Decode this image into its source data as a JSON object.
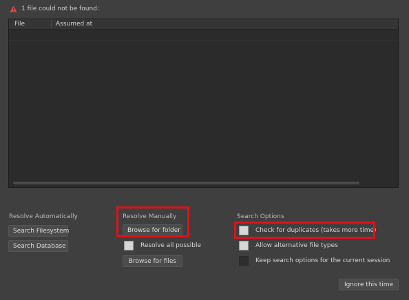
{
  "header": {
    "warning_text": "1 file could not be found:",
    "icon": "warning-triangle-icon",
    "icon_color": "#e04a4a"
  },
  "table": {
    "columns": [
      "File",
      "Assumed at"
    ],
    "rows": []
  },
  "resolve_automatically": {
    "title": "Resolve Automatically",
    "search_filesystem": "Search Filesystem",
    "search_database": "Search Database"
  },
  "resolve_manually": {
    "title": "Resolve Manually",
    "browse_folder": "Browse for folder",
    "resolve_all_label": "Resolve all possible",
    "resolve_all_checked": false,
    "browse_files": "Browse for files"
  },
  "search_options": {
    "title": "Search Options",
    "check_duplicates": "Check for duplicates (takes more time)",
    "allow_alt_types": "Allow alternative file types",
    "keep_options": "Keep search options for the current session"
  },
  "footer": {
    "ignore_label": "Ignore this time"
  },
  "colors": {
    "background": "#3f3f3f",
    "table_bg": "#2b2b2b",
    "highlight": "#e3101a"
  }
}
